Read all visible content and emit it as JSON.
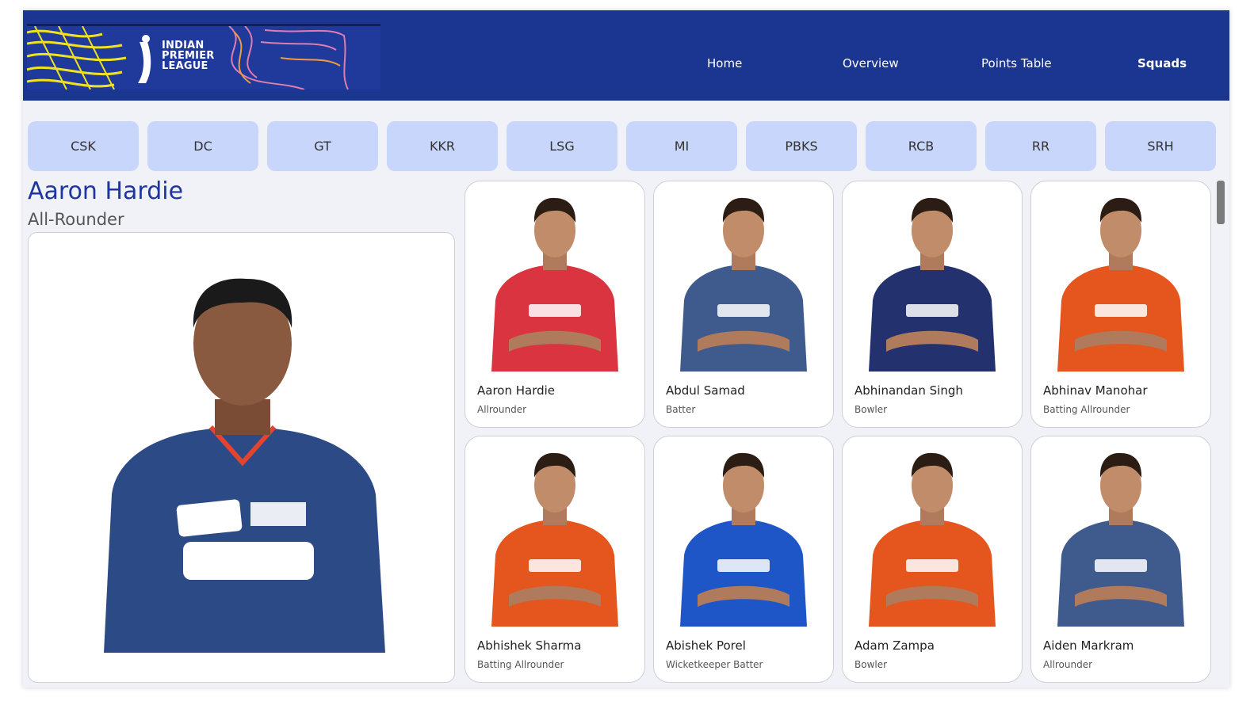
{
  "header": {
    "logo": {
      "line1": "INDIAN",
      "line2": "PREMIER",
      "line3": "LEAGUE"
    },
    "nav": [
      {
        "label": "Home"
      },
      {
        "label": "Overview"
      },
      {
        "label": "Points Table"
      },
      {
        "label": "Squads",
        "active": true
      }
    ]
  },
  "teams": [
    "CSK",
    "DC",
    "GT",
    "KKR",
    "LSG",
    "MI",
    "PBKS",
    "RCB",
    "RR",
    "SRH"
  ],
  "selected_player": {
    "name": "Aaron Hardie",
    "role": "All-Rounder",
    "jersey_color": "#2c4a86"
  },
  "players": [
    {
      "name": "Aaron Hardie",
      "role": "Allrounder",
      "jersey_color": "#d9343f"
    },
    {
      "name": "Abdul Samad",
      "role": "Batter",
      "jersey_color": "#3f5a8c"
    },
    {
      "name": "Abhinandan Singh",
      "role": "Bowler",
      "jersey_color": "#23326e"
    },
    {
      "name": "Abhinav Manohar",
      "role": "Batting Allrounder",
      "jersey_color": "#e4561d"
    },
    {
      "name": "Abhishek Sharma",
      "role": "Batting Allrounder",
      "jersey_color": "#e4561d"
    },
    {
      "name": "Abishek Porel",
      "role": "Wicketkeeper Batter",
      "jersey_color": "#1e56c8"
    },
    {
      "name": "Adam Zampa",
      "role": "Bowler",
      "jersey_color": "#e4561d"
    },
    {
      "name": "Aiden Markram",
      "role": "Allrounder",
      "jersey_color": "#3f5a8c"
    }
  ],
  "colors": {
    "header_bg": "#1a3690",
    "team_button_bg": "#c8d6fb",
    "player_name": "#1d35a0",
    "page_bg": "#f1f2f7"
  }
}
